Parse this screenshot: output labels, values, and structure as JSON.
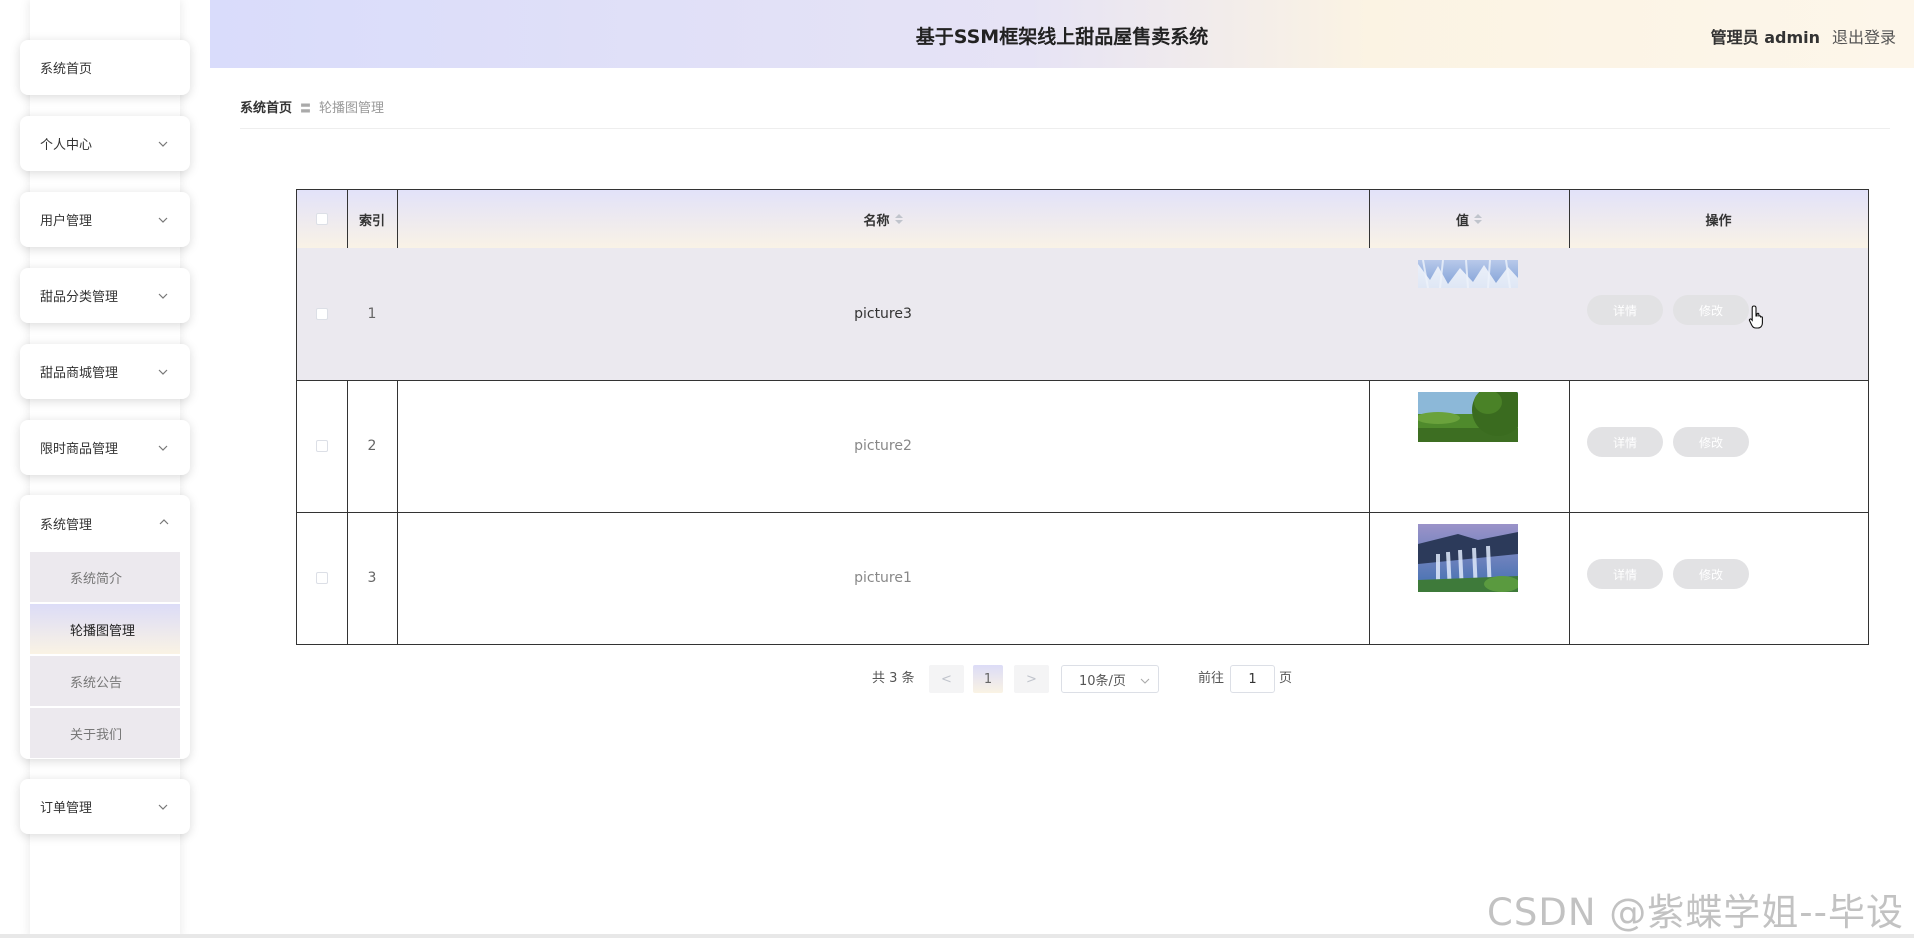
{
  "header": {
    "title": "基于SSM框架线上甜品屋售卖系统",
    "user_role": "管理员 admin",
    "logout": "退出登录"
  },
  "sidebar": {
    "items": [
      {
        "label": "系统首页"
      },
      {
        "label": "个人中心"
      },
      {
        "label": "用户管理"
      },
      {
        "label": "甜品分类管理"
      },
      {
        "label": "甜品商城管理"
      },
      {
        "label": "限时商品管理"
      }
    ],
    "group": {
      "label": "系统管理",
      "sub_items": [
        {
          "label": "系统简介"
        },
        {
          "label": "轮播图管理"
        },
        {
          "label": "系统公告"
        },
        {
          "label": "关于我们"
        }
      ]
    },
    "last_item": {
      "label": "订单管理"
    }
  },
  "breadcrumb": {
    "home": "系统首页",
    "separator": "〓",
    "current": "轮播图管理"
  },
  "table": {
    "columns": [
      "索引",
      "名称",
      "值",
      "操作"
    ],
    "rows": [
      {
        "index": "1",
        "name": "picture3",
        "image": "waterfall-snow",
        "details_label": "详情",
        "edit_label": "修改"
      },
      {
        "index": "2",
        "name": "picture2",
        "image": "green-trees",
        "details_label": "详情",
        "edit_label": "修改"
      },
      {
        "index": "3",
        "name": "picture1",
        "image": "waterfall-rocks",
        "details_label": "详情",
        "edit_label": "修改"
      }
    ]
  },
  "pagination": {
    "total": "共 3 条",
    "prev": "<",
    "current_page": "1",
    "next": ">",
    "page_size": "10条/页",
    "goto_label": "前往",
    "goto_value": "1",
    "page_suffix": "页"
  },
  "watermark": "CSDN @紫蝶学姐--毕设",
  "colors": {
    "header_gradient_start": "#d9dcfb",
    "header_gradient_end": "#fdf6ea",
    "table_border": "#333333",
    "button_bg": "#e2e2e4"
  }
}
